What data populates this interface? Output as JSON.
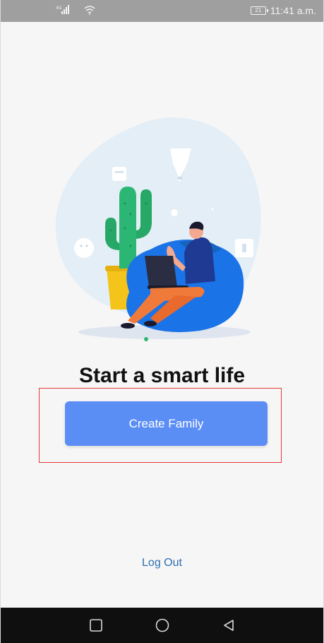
{
  "status_bar": {
    "network": "⁴ᴳ",
    "time": "11:41 a.m.",
    "battery": "21"
  },
  "main": {
    "title": "Start a smart life",
    "create_family_label": "Create Family",
    "logout_label": "Log Out"
  },
  "nav": {
    "icons": [
      "square-icon",
      "circle-icon",
      "back-triangle-icon"
    ]
  },
  "colors": {
    "accent": "#5b8ef5",
    "link": "#2f6fb2",
    "highlight": "#e53935",
    "blob": "#e3eef7",
    "chair": "#1b73e8",
    "cactus": "#2bb673"
  }
}
